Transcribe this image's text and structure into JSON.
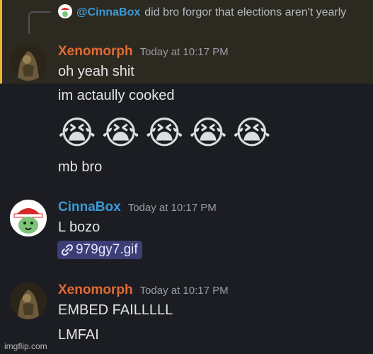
{
  "reply": {
    "author": "@CinnaBox",
    "text": "did bro forgor that elections aren't yearly"
  },
  "groups": [
    {
      "author": "Xenomorph",
      "timestamp": "Today at 10:17 PM",
      "messages": [
        "oh yeah shit",
        "im actaully cooked",
        "mb bro"
      ],
      "emojis": [
        "😭",
        "😭",
        "😭",
        "😭",
        "😭"
      ]
    },
    {
      "author": "CinnaBox",
      "timestamp": "Today at 10:17 PM",
      "messages": [
        "L bozo"
      ],
      "attachment": "979gy7.gif"
    },
    {
      "author": "Xenomorph",
      "timestamp": "Today at 10:17 PM",
      "messages": [
        "EMBED FAILLLLL",
        "LMFAI"
      ]
    }
  ],
  "watermark": "imgflip.com",
  "colors": {
    "xenomorph_name": "#e36a34",
    "cinnabox_name": "#3a9bd8",
    "highlight_bar": "#f0b232",
    "attachment_bg": "#3c3e75"
  }
}
